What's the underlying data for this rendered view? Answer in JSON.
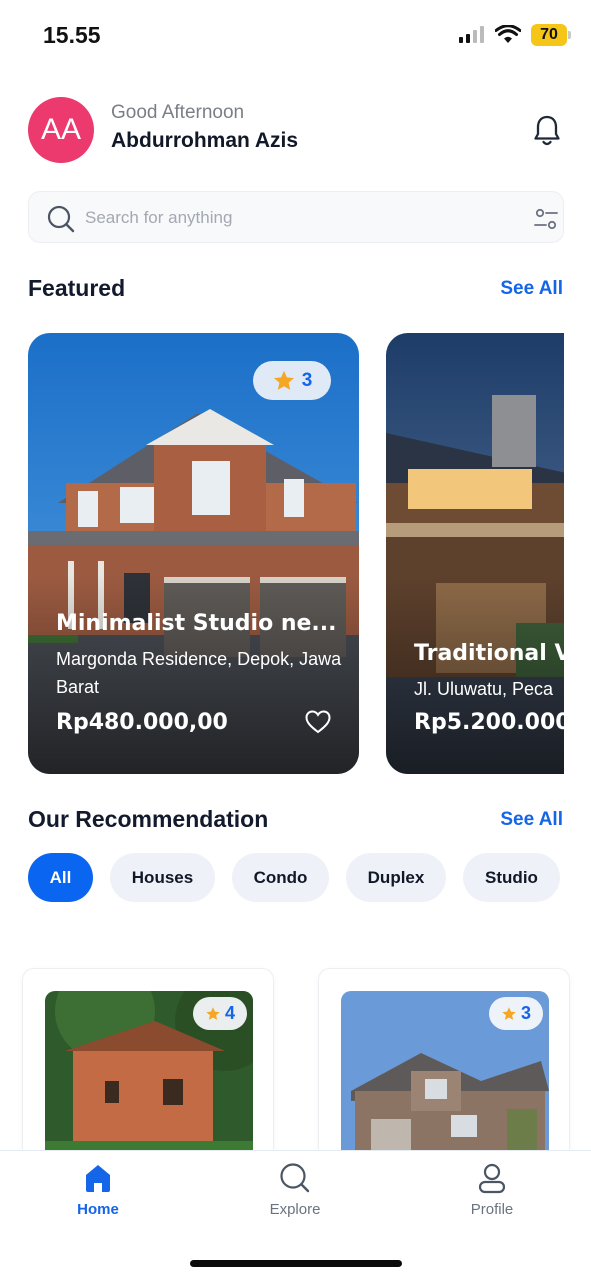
{
  "status_bar": {
    "time": "15.55",
    "battery": "70"
  },
  "header": {
    "avatar_initials": "AA",
    "greeting": "Good Afternoon",
    "user_name": "Abdurrohman Azis"
  },
  "search": {
    "placeholder": "Search for anything",
    "value": ""
  },
  "featured": {
    "title": "Featured",
    "see_all": "See All",
    "cards": [
      {
        "rating": "3",
        "title": "Minimalist Studio ne...",
        "address": "Margonda Residence, Depok, Jawa Barat",
        "price": "Rp480.000,00"
      },
      {
        "title": "Traditional V",
        "address": "Jl. Uluwatu, Peca",
        "price": "Rp5.200.000"
      }
    ]
  },
  "recommendation": {
    "title": "Our Recommendation",
    "see_all": "See All",
    "filters": [
      "All",
      "Houses",
      "Condo",
      "Duplex",
      "Studio"
    ],
    "active_filter": "All",
    "cards": [
      {
        "rating": "4"
      },
      {
        "rating": "3"
      }
    ]
  },
  "bottom_nav": [
    {
      "label": "Home",
      "icon": "home-icon",
      "active": true
    },
    {
      "label": "Explore",
      "icon": "search-icon",
      "active": false
    },
    {
      "label": "Profile",
      "icon": "profile-icon",
      "active": false
    }
  ],
  "colors": {
    "accent": "#1565e8",
    "avatar": "#ec3a6e",
    "star": "#f5a623",
    "battery": "#f5c518"
  }
}
